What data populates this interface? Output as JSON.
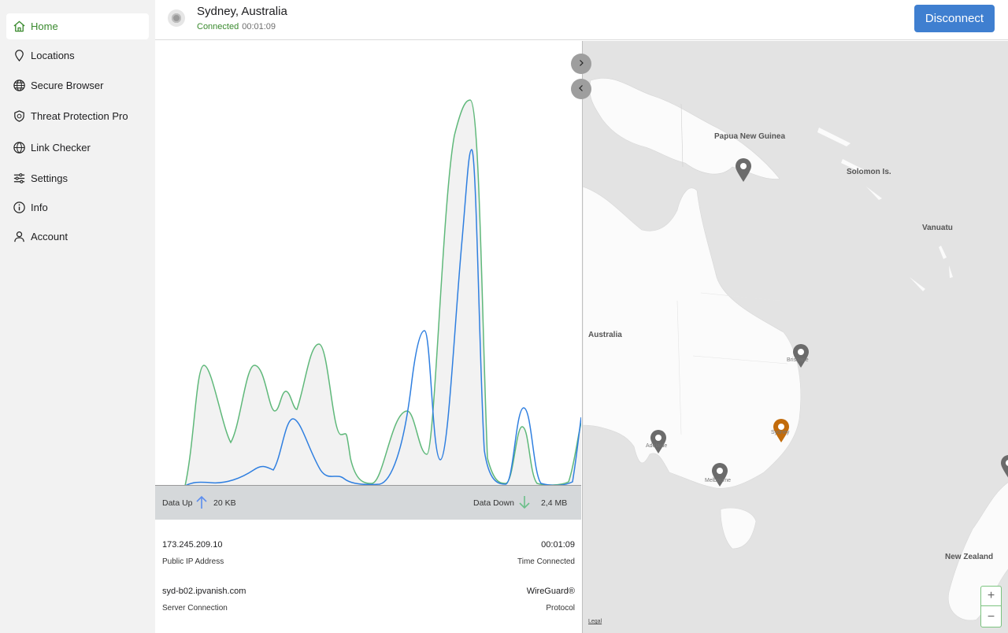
{
  "sidebar": {
    "items": [
      {
        "label": "Home",
        "icon": "home-icon",
        "active": true
      },
      {
        "label": "Locations",
        "icon": "location-pin-icon"
      },
      {
        "label": "Secure Browser",
        "icon": "globe-icon"
      },
      {
        "label": "Threat Protection Pro",
        "icon": "shield-icon"
      },
      {
        "label": "Link Checker",
        "icon": "globe-link-icon"
      },
      {
        "label": "Settings",
        "icon": "sliders-icon"
      },
      {
        "label": "Info",
        "icon": "info-icon"
      },
      {
        "label": "Account",
        "icon": "person-icon"
      }
    ]
  },
  "header": {
    "location": "Sydney, Australia",
    "status": "Connected",
    "duration": "00:01:09",
    "disconnect_label": "Disconnect"
  },
  "traffic": {
    "up_label": "Data Up",
    "up_value": "20 KB",
    "down_label": "Data Down",
    "down_value": "2,4 MB"
  },
  "connection": {
    "ip": "173.245.209.10",
    "ip_label": "Public IP Address",
    "time": "00:01:09",
    "time_label": "Time Connected",
    "server": "syd-b02.ipvanish.com",
    "server_label": "Server Connection",
    "protocol": "WireGuard®",
    "protocol_label": "Protocol"
  },
  "map": {
    "labels": {
      "png": "Papua New Guinea",
      "solomon": "Solomon Is.",
      "vanuatu": "Vanuatu",
      "australia": "Australia",
      "nz": "New Zealand",
      "brisbane": "Brisbane",
      "sydney": "Sydney",
      "adelaide": "Adelaide",
      "melbourne": "Melbourne"
    },
    "legal": "Legal",
    "zoom_in": "+",
    "zoom_out": "−"
  },
  "colors": {
    "accent_green": "#3a8a2e",
    "button_blue": "#3f7fd0",
    "pin_active": "#c26b0a",
    "pin_inactive": "#6b6b6b",
    "line_up": "#2f7fe0",
    "line_down": "#5fb87a"
  }
}
